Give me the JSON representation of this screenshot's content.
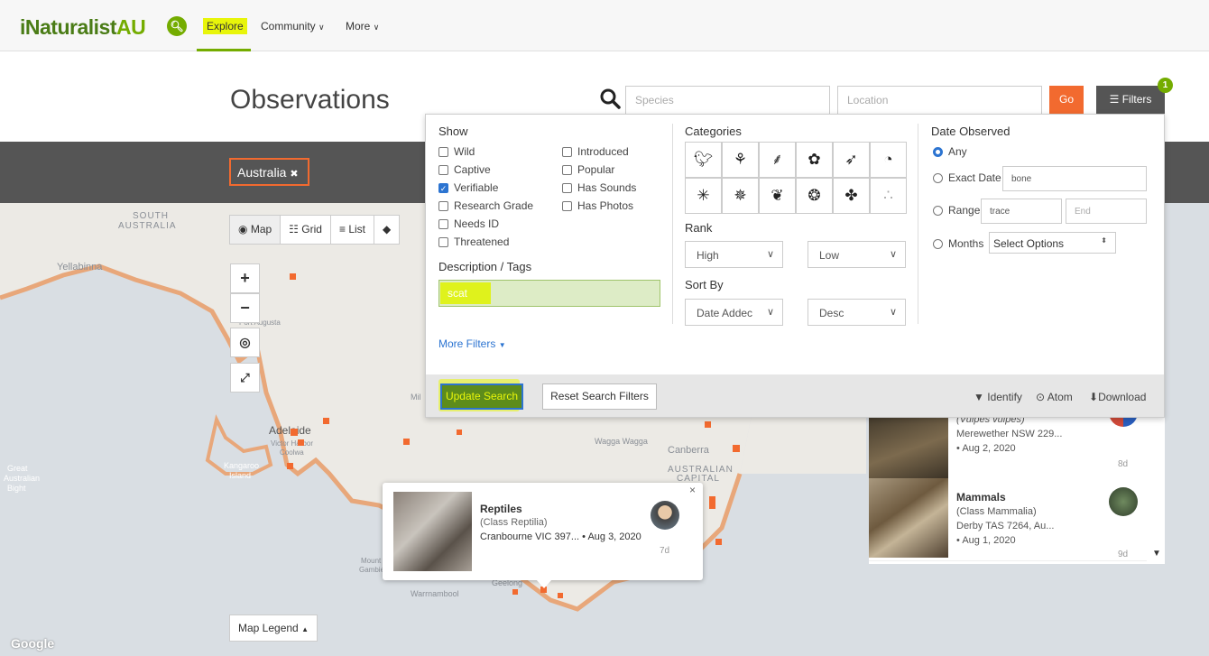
{
  "nav": {
    "logo_main": "iNaturalist",
    "logo_suffix": "AU",
    "explore": "Explore",
    "community": "Community",
    "more": "More"
  },
  "page": {
    "title": "Observations",
    "species_placeholder": "Species",
    "location_placeholder": "Location",
    "go_label": "Go",
    "filters_label": "Filters",
    "filters_count": "1",
    "place_chip": "Australia"
  },
  "view_tabs": [
    "Map",
    "Grid",
    "List"
  ],
  "map": {
    "labels": [
      "SOUTH",
      "AUSTRALIA",
      "Yellabinna",
      "Port Augusta",
      "Adelaide",
      "Victor Harbor",
      "Coolwa",
      "Kangaroo",
      "Island",
      "Great",
      "Australian",
      "Bight",
      "Wagga Wagga",
      "Canberra",
      "AUSTRALIAN",
      "CAPITAL",
      "Warrnambool",
      "Geelong",
      "Mount",
      "Gambier",
      "Mil"
    ],
    "legend_label": "Map Legend",
    "google": "Google"
  },
  "popup": {
    "name": "Reptiles",
    "sci": "(Class Reptilia)",
    "location": "Cranbourne VIC 397...",
    "date": "Aug 3, 2020",
    "age": "7d",
    "close": "×"
  },
  "results": [
    {
      "title": "",
      "sub1": "(Vulpes vulpes)",
      "sub2": "Merewether NSW 229...",
      "sub3": "Aug 2, 2020",
      "age": "8d"
    },
    {
      "title": "Mammals",
      "sub1": "(Class Mammalia)",
      "sub2": "Derby TAS 7264, Au...",
      "sub3": "Aug 1, 2020",
      "age": "9d"
    }
  ],
  "filters": {
    "show_title": "Show",
    "show_left": [
      {
        "label": "Wild",
        "checked": false
      },
      {
        "label": "Captive",
        "checked": false
      },
      {
        "label": "Verifiable",
        "checked": true
      },
      {
        "label": "Research Grade",
        "checked": false
      },
      {
        "label": "Needs ID",
        "checked": false
      },
      {
        "label": "Threatened",
        "checked": false
      }
    ],
    "show_right": [
      {
        "label": "Introduced",
        "checked": false
      },
      {
        "label": "Popular",
        "checked": false
      },
      {
        "label": "Has Sounds",
        "checked": false
      },
      {
        "label": "Has Photos",
        "checked": false
      }
    ],
    "desc_title": "Description / Tags",
    "desc_value": "scat",
    "more_filters": "More Filters",
    "categories_title": "Categories",
    "rank_title": "Rank",
    "rank_high": "High",
    "rank_low": "Low",
    "sort_title": "Sort By",
    "sort_by": "Date Addec",
    "sort_order": "Desc",
    "date_title": "Date Observed",
    "date_any": "Any",
    "date_exact": "Exact Date",
    "date_exact_value": "bone",
    "date_range": "Range",
    "range_start": "trace",
    "range_end_placeholder": "End",
    "date_months": "Months",
    "months_select": "Select Options",
    "update_button": "Update Search",
    "reset_button": "Reset Search Filters",
    "identify": "Identify",
    "atom": "Atom",
    "download": "Download"
  },
  "colors": {
    "brand": "#74ac00",
    "accent": "#f26a2f",
    "highlight": "#e8f50a"
  }
}
